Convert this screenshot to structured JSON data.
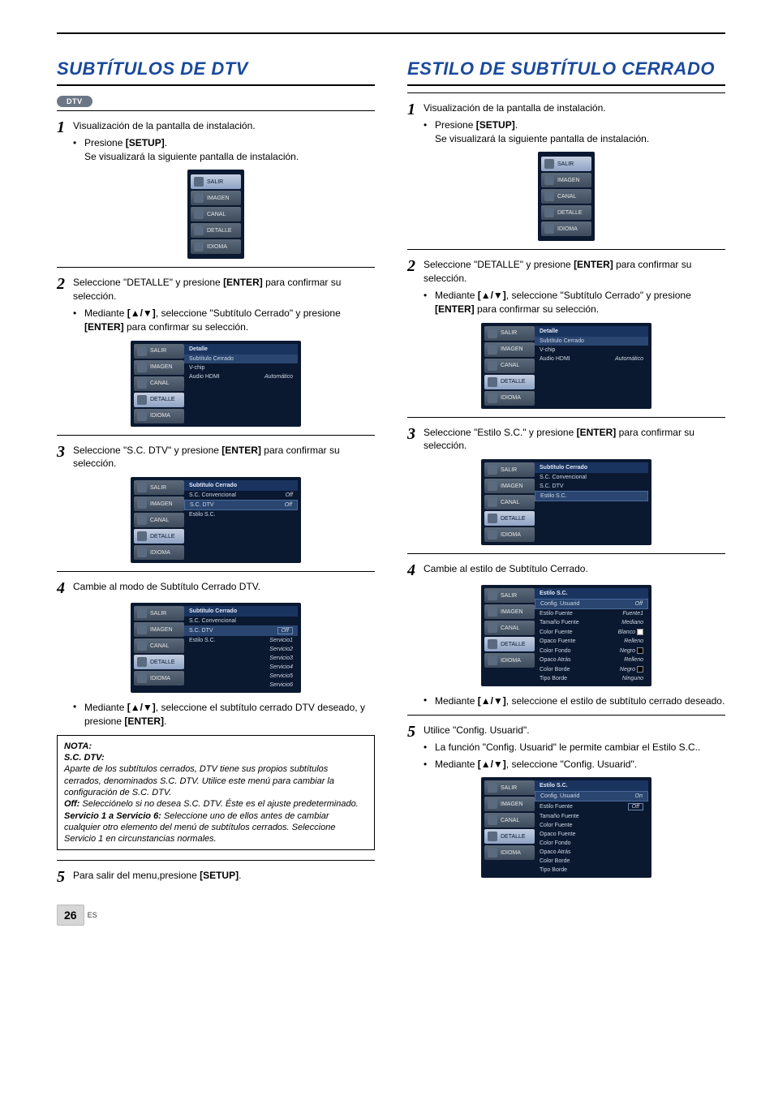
{
  "page": {
    "number": "26",
    "lang": "ES"
  },
  "left": {
    "title": "SUBTÍTULOS DE DTV",
    "badge": "DTV",
    "step1": {
      "text": "Visualización de la pantalla de instalación.",
      "bullet_pre": "Presione ",
      "bullet_bold": "[SETUP]",
      "bullet_post": ".",
      "bullet_line2": "Se visualizará la siguiente pantalla de instalación."
    },
    "menu1": [
      "SALIR",
      "IMAGEN",
      "CANAL",
      "DETALLE",
      "IDIOMA"
    ],
    "step2": {
      "pre": "Seleccione \"DETALLE\" y presione ",
      "bold": "[ENTER]",
      "post": " para confirmar su selección.",
      "b_pre": "Mediante ",
      "b_bold": "[▲/▼]",
      "b_mid": ", seleccione \"Subtítulo Cerrado\" y presione ",
      "b_bold2": "[ENTER]",
      "b_post": " para confirmar su selección."
    },
    "panel2": {
      "header": "Detalle",
      "rows": [
        {
          "l": "Subtítulo Cerrado",
          "r": ""
        },
        {
          "l": "V-chip",
          "r": ""
        },
        {
          "l": "Audio HDMI",
          "r": "Automático"
        }
      ]
    },
    "step3": {
      "pre": "Seleccione \"S.C. DTV\" y presione ",
      "bold": "[ENTER]",
      "post": " para confirmar su selección."
    },
    "panel3": {
      "header": "Subtítulo Cerrado",
      "rows": [
        {
          "l": "S.C. Convencional",
          "r": "Off"
        },
        {
          "l": "S.C. DTV",
          "r": "Off"
        },
        {
          "l": "Estilo S.C.",
          "r": ""
        }
      ]
    },
    "step4": {
      "text": "Cambie al modo de Subtítulo Cerrado DTV."
    },
    "panel4": {
      "header": "Subtítulo Cerrado",
      "rows": [
        {
          "l": "S.C. Convencional",
          "r": ""
        },
        {
          "l": "S.C. DTV",
          "r": "Off"
        },
        {
          "l": "Estilo S.C.",
          "r": "Servicio1"
        }
      ],
      "extra": [
        "Servicio2",
        "Servicio3",
        "Servicio4",
        "Servicio5",
        "Servicio6"
      ]
    },
    "after4": {
      "pre": "Mediante ",
      "bold": "[▲/▼]",
      "mid": ", seleccione el subtítulo cerrado DTV deseado, y presione ",
      "bold2": "[ENTER]",
      "post": "."
    },
    "note": {
      "head": "NOTA:",
      "sub": "S.C. DTV:",
      "body1": "Aparte de los subtítulos cerrados, DTV tiene sus propios subtítulos cerrados, denominados S.C. DTV. Utilice este menú para cambiar la configuración de S.C. DTV.",
      "off_b": "Off:",
      "off_t": " Selecciónelo si no desea S.C. DTV. Éste es el ajuste predeterminado.",
      "srv_b": "Servicio 1 a Servicio 6:",
      "srv_t": " Seleccione uno de ellos antes de cambiar cualquier otro elemento del menú de subtítulos cerrados. Seleccione Servicio 1 en circunstancias normales."
    },
    "step5": {
      "pre": "Para salir del menu,presione ",
      "bold": "[SETUP]",
      "post": "."
    }
  },
  "right": {
    "title": "ESTILO DE SUBTÍTULO CERRADO",
    "step1": {
      "text": "Visualización de la pantalla de instalación.",
      "bullet_pre": "Presione ",
      "bullet_bold": "[SETUP]",
      "bullet_post": ".",
      "bullet_line2": "Se visualizará la siguiente pantalla de instalación."
    },
    "menu1": [
      "SALIR",
      "IMAGEN",
      "CANAL",
      "DETALLE",
      "IDIOMA"
    ],
    "step2": {
      "pre": "Seleccione \"DETALLE\" y presione ",
      "bold": "[ENTER]",
      "post": " para confirmar su selección.",
      "b_pre": "Mediante ",
      "b_bold": "[▲/▼]",
      "b_mid": ", seleccione \"Subtítulo Cerrado\" y presione ",
      "b_bold2": "[ENTER]",
      "b_post": " para confirmar su selección."
    },
    "panel2": {
      "header": "Detalle",
      "rows": [
        {
          "l": "Subtítulo Cerrado",
          "r": ""
        },
        {
          "l": "V-chip",
          "r": ""
        },
        {
          "l": "Audio HDMI",
          "r": "Automático"
        }
      ]
    },
    "step3": {
      "pre": "Seleccione \"Estilo S.C.\" y presione ",
      "bold": "[ENTER]",
      "post": " para confirmar su selección."
    },
    "panel3": {
      "header": "Subtítulo Cerrado",
      "rows": [
        {
          "l": "S.C. Convencional",
          "r": ""
        },
        {
          "l": "S.C. DTV",
          "r": ""
        },
        {
          "l": "Estilo S.C.",
          "r": ""
        }
      ]
    },
    "step4": {
      "text": "Cambie al estilo de Subtítulo Cerrado."
    },
    "panel4": {
      "header": "Estilo S.C.",
      "rows": [
        {
          "l": "Config. Usuarid",
          "r": "Off"
        },
        {
          "l": "Estilo Fuente",
          "r": "Fuente1"
        },
        {
          "l": "Tamaño Fuente",
          "r": "Mediano"
        },
        {
          "l": "Color Fuente",
          "r": "Blanco"
        },
        {
          "l": "Opaco Fuente",
          "r": "Relleno"
        },
        {
          "l": "Color Fondo",
          "r": "Negro"
        },
        {
          "l": "Opaco Atrás",
          "r": "Relleno"
        },
        {
          "l": "Color Borde",
          "r": "Negro"
        },
        {
          "l": "Tipo Borde",
          "r": "Ninguno"
        }
      ]
    },
    "after4": {
      "pre": "Mediante ",
      "bold": "[▲/▼]",
      "post": ", seleccione el estilo de subtítulo cerrado deseado."
    },
    "step5": {
      "text": "Utilice \"Config. Usuarid\".",
      "b1": "La función \"Config. Usuarid\" le permite cambiar el Estilo S.C..",
      "b2_pre": "Mediante ",
      "b2_bold": "[▲/▼]",
      "b2_post": ", seleccione \"Config. Usuarid\"."
    },
    "panel5": {
      "header": "Estilo S.C.",
      "rows": [
        {
          "l": "Config. Usuarid",
          "r": "On"
        },
        {
          "l": "Estilo Fuente",
          "r": "Off"
        },
        {
          "l": "Tamaño Fuente",
          "r": ""
        },
        {
          "l": "Color Fuente",
          "r": ""
        },
        {
          "l": "Opaco Fuente",
          "r": ""
        },
        {
          "l": "Color Fondo",
          "r": ""
        },
        {
          "l": "Opaco Atrás",
          "r": ""
        },
        {
          "l": "Color Borde",
          "r": ""
        },
        {
          "l": "Tipo Borde",
          "r": ""
        }
      ]
    }
  }
}
